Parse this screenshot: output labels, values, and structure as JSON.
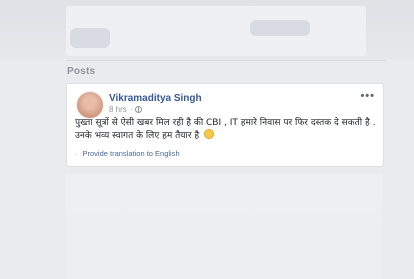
{
  "section": {
    "title": "Posts"
  },
  "post": {
    "author": "Vikramaditya Singh",
    "time": "8 hrs",
    "privacy_icon": "globe-icon",
    "more_icon": "ellipsis-icon",
    "text": "पुख्ता सूत्रों से ऐसी खबर मिल रही है की CBI , IT हमारे निवास पर फिर दस्तक दे सकती है . उनके भव्य स्वागत के लिए हम तैयार है",
    "emoji": "smile-emoji-icon",
    "translate_sep": "·",
    "translate_label": "Provide translation to English"
  },
  "colors": {
    "author": "#365899",
    "page_bg": "#e9ebee",
    "link": "#4b67a1"
  }
}
